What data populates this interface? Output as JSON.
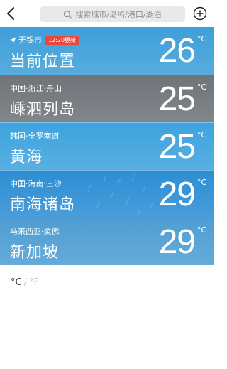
{
  "header": {
    "search_placeholder": "搜索城市/岛屿/港口/湖泊"
  },
  "cards": [
    {
      "region": "无锡市",
      "name": "当前位置",
      "temp": "26",
      "unit": "°C",
      "update_badge": "12:20更新",
      "current_location": true,
      "bg": "#3e9fd8"
    },
    {
      "region": "中国·浙江·舟山",
      "name": "嵊泗列岛",
      "temp": "25",
      "unit": "°C",
      "bg": "#6f7479"
    },
    {
      "region": "韩国·全罗南道",
      "name": "黄海",
      "temp": "25",
      "unit": "°C",
      "bg": "#3ea3de"
    },
    {
      "region": "中国·海南·三沙",
      "name": "南海诸岛",
      "temp": "29",
      "unit": "°C",
      "bg": "#2d8ed4"
    },
    {
      "region": "马来西亚·柔佛",
      "name": "新加坡",
      "temp": "29",
      "unit": "°C",
      "bg": "#4e9ed3"
    }
  ],
  "units_toggle": {
    "celsius": "°C",
    "separator": "/",
    "fahrenheit": "°F",
    "selected": "celsius"
  },
  "icons": [
    "back-chevron-icon",
    "search-icon",
    "add-circle-icon",
    "location-arrow-icon"
  ]
}
